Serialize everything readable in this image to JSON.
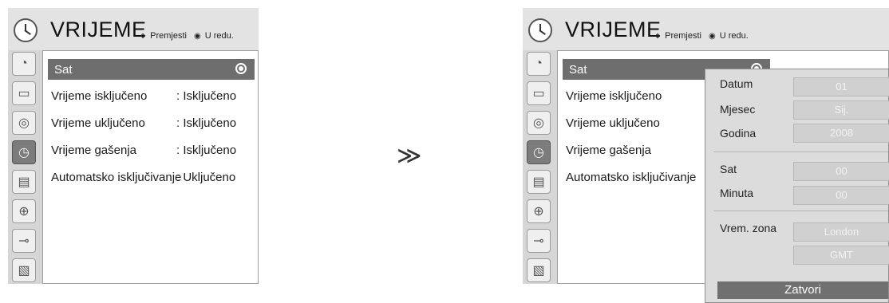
{
  "left_panel": {
    "title": "VRIJEME",
    "hint_move": "Premjesti",
    "hint_ok": "U redu.",
    "selected_item": "Sat",
    "rows": [
      {
        "label": "Vrijeme isključeno",
        "value": ": Isključeno"
      },
      {
        "label": "Vrijeme uključeno",
        "value": ": Isključeno"
      },
      {
        "label": "Vrijeme gašenja",
        "value": ": Isključeno"
      },
      {
        "label": "Automatsko isključivanje",
        "value": ": Uključeno"
      }
    ]
  },
  "arrow": "≫",
  "right_panel": {
    "title": "VRIJEME",
    "hint_move": "Premjesti",
    "hint_ok": "U redu.",
    "selected_item": "Sat",
    "rows": [
      {
        "label": "Vrijeme isključeno"
      },
      {
        "label": "Vrijeme uključeno"
      },
      {
        "label": "Vrijeme gašenja"
      },
      {
        "label": "Automatsko isključivanje"
      }
    ]
  },
  "popup": {
    "fields": [
      {
        "label": "Datum",
        "value": "01"
      },
      {
        "label": "Mjesec",
        "value": "Sij."
      },
      {
        "label": "Godina",
        "value": "2008"
      },
      {
        "label": "Sat",
        "value": "00"
      },
      {
        "label": "Minuta",
        "value": "00"
      },
      {
        "label": "Vrem. zona",
        "value": "London"
      },
      {
        "label": "",
        "value": "GMT"
      }
    ],
    "close_label": "Zatvori"
  },
  "sidebar_icons": [
    "satellite-dish-icon",
    "monitor-icon",
    "speaker-icon",
    "clock-icon",
    "calendar-icon",
    "lock-icon",
    "plug-icon",
    "photos-icon"
  ]
}
